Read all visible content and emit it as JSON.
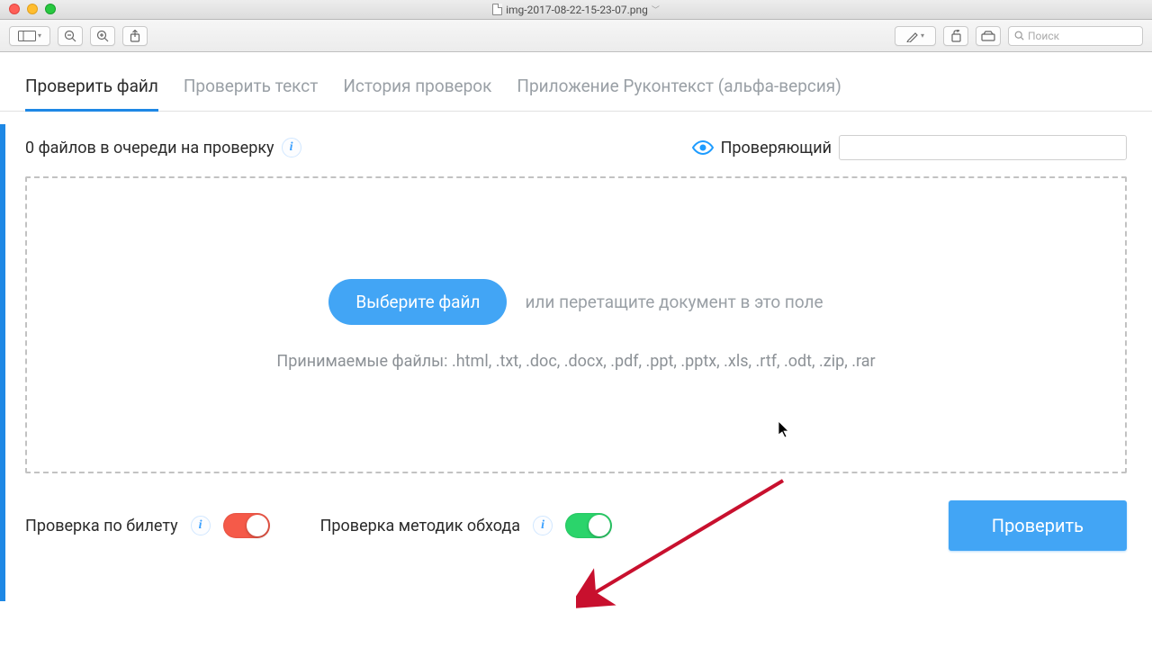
{
  "window": {
    "filename": "img-2017-08-22-15-23-07.png",
    "search_placeholder": "Поиск"
  },
  "tabs": {
    "file": "Проверить файл",
    "text": "Проверить текст",
    "history": "История проверок",
    "app": "Приложение Руконтекст (альфа-версия)"
  },
  "queue": {
    "label": "0 файлов в очереди на проверку"
  },
  "reviewer": {
    "label": "Проверяющий",
    "value": ""
  },
  "dropzone": {
    "choose_button": "Выберите файл",
    "drag_text": "или перетащите документ в это поле",
    "accepted_text": "Принимаемые файлы: .html, .txt, .doc, .docx, .pdf, .ppt, .pptx, .xls, .rtf, .odt, .zip, .rar"
  },
  "options": {
    "ticket_check": "Проверка по билету",
    "bypass_check": "Проверка методик обхода"
  },
  "buttons": {
    "check": "Проверить"
  }
}
